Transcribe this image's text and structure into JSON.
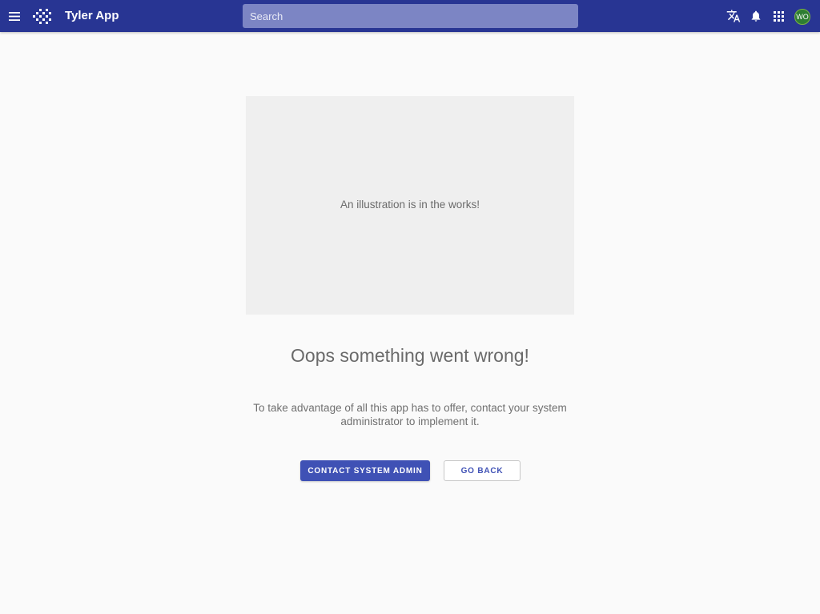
{
  "header": {
    "app_title": "Tyler App",
    "search_placeholder": "Search",
    "avatar_initials": "WO",
    "icons": [
      "menu-icon",
      "tyler-logo-icon",
      "translate-icon",
      "bell-icon",
      "apps-grid-icon"
    ],
    "bar_color": "#283593",
    "avatar_color": "#2e7d32"
  },
  "main": {
    "illustration_text": "An illustration is in the works!",
    "title": "Oops something went wrong!",
    "message": "To take advantage of all this app has to offer, contact your system administrator to implement it.",
    "contact_button_label": "CONTACT SYSTEM ADMIN",
    "back_button_label": "GO BACK",
    "accent_color": "#3f51b5"
  }
}
